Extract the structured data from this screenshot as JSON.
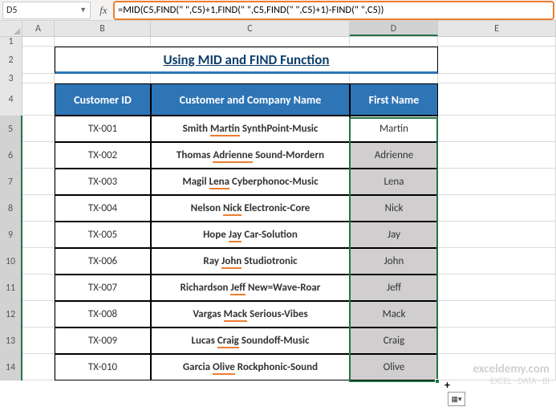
{
  "nameBox": {
    "value": "D5"
  },
  "formulaBar": {
    "formula": "=MID(C5,FIND(\" \",C5)+1,FIND(\" \",C5,FIND(\" \",C5)+1)-FIND(\" \",C5))"
  },
  "columns": [
    "A",
    "B",
    "C",
    "D",
    "E"
  ],
  "activeColumn": "D",
  "rowLabels": [
    "1",
    "2",
    "3",
    "4",
    "5",
    "6",
    "7",
    "8",
    "9",
    "10",
    "11",
    "12",
    "13",
    "14"
  ],
  "title": "Using MID and FIND Function",
  "headers": {
    "id": "Customer ID",
    "name": "Customer and Company Name",
    "first": "First Name"
  },
  "rows": [
    {
      "id": "TX-001",
      "pre": "Smith ",
      "mid": "Martin",
      "post": " SynthPoint-Music",
      "first": "Martin",
      "firstWhite": true
    },
    {
      "id": "TX-002",
      "pre": "Thomas ",
      "mid": "Adrienne",
      "post": " Sound-Mordern",
      "first": "Adrienne"
    },
    {
      "id": "TX-003",
      "pre": "Magil ",
      "mid": "Lena",
      "post": " Cyberphonoc-Music",
      "first": "Lena"
    },
    {
      "id": "TX-004",
      "pre": "Nelson ",
      "mid": "Nick",
      "post": " Electronic-Core",
      "first": "Nick"
    },
    {
      "id": "TX-005",
      "pre": "Hope ",
      "mid": "Jay",
      "post": " Car-Solution",
      "first": "Jay"
    },
    {
      "id": "TX-006",
      "pre": "Ray ",
      "mid": "John",
      "post": " Studiotronic",
      "first": "John"
    },
    {
      "id": "TX-007",
      "pre": "Richardson ",
      "mid": "Jeff",
      "post": " New=Wave-Roar",
      "first": "Jeff"
    },
    {
      "id": "TX-008",
      "pre": "Vargas ",
      "mid": "Mack",
      "post": " Serious-Vibes",
      "first": "Mack"
    },
    {
      "id": "TX-009",
      "pre": "Lucas ",
      "mid": "Craig",
      "post": " Soundoff-Music",
      "first": "Craig"
    },
    {
      "id": "TX-010",
      "pre": "Garcia ",
      "mid": "Olive",
      "post": " Rockphonic-Sound",
      "first": "Olive"
    }
  ],
  "watermark": {
    "line1": "exceldemy.com",
    "line2": "EXCEL · DATA · BI"
  }
}
